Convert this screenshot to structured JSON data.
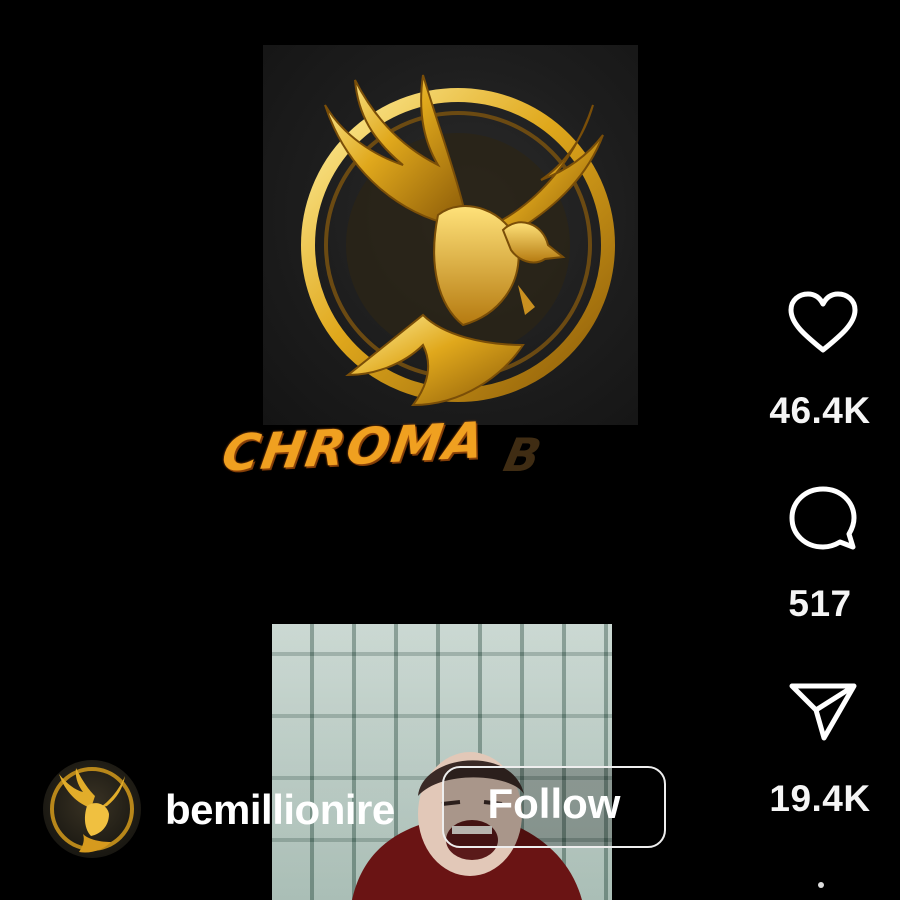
{
  "post": {
    "brand_text": "CHROMA",
    "brand_text_tail": "B"
  },
  "actions": {
    "likes": "46.4K",
    "comments": "517",
    "shares": "19.4K"
  },
  "user": {
    "username": "bemillionire",
    "follow_label": "Follow"
  },
  "icons": {
    "like": "heart-icon",
    "comment": "comment-bubble-icon",
    "share": "paper-plane-icon",
    "more": "more-vertical-icon"
  },
  "colors": {
    "background": "#000000",
    "gold": "#d8a520",
    "brand_orange": "#f0a020"
  }
}
